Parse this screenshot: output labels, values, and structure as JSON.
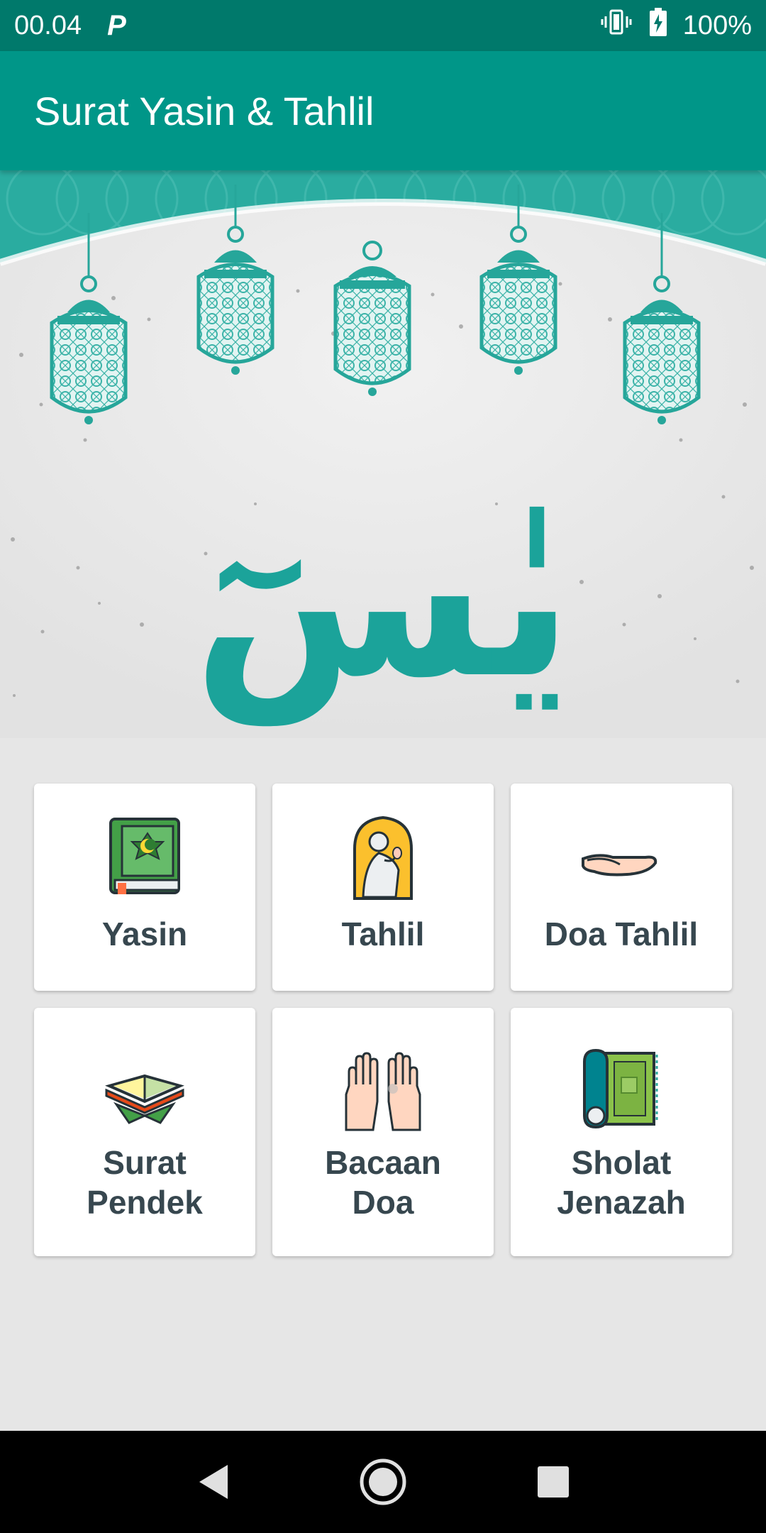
{
  "status_bar": {
    "time": "00.04",
    "notification_icon": "P",
    "battery": "100%"
  },
  "app_bar": {
    "title": "Surat Yasin & Tahlil"
  },
  "hero": {
    "calligraphy": "يٰسٓ",
    "accent_color": "#26a69a"
  },
  "menu": [
    {
      "label": "Yasin",
      "icon": "quran-book-icon"
    },
    {
      "label": "Tahlil",
      "icon": "praying-man-icon"
    },
    {
      "label": "Doa Tahlil",
      "icon": "open-hand-icon"
    },
    {
      "label": "Surat\nPendek",
      "icon": "open-quran-stand-icon"
    },
    {
      "label": "Bacaan\nDoa",
      "icon": "praying-hands-icon"
    },
    {
      "label": "Sholat\nJenazah",
      "icon": "prayer-mat-icon"
    }
  ],
  "colors": {
    "status_bar": "#00796b",
    "app_bar": "#009688",
    "label_text": "#37474f"
  }
}
